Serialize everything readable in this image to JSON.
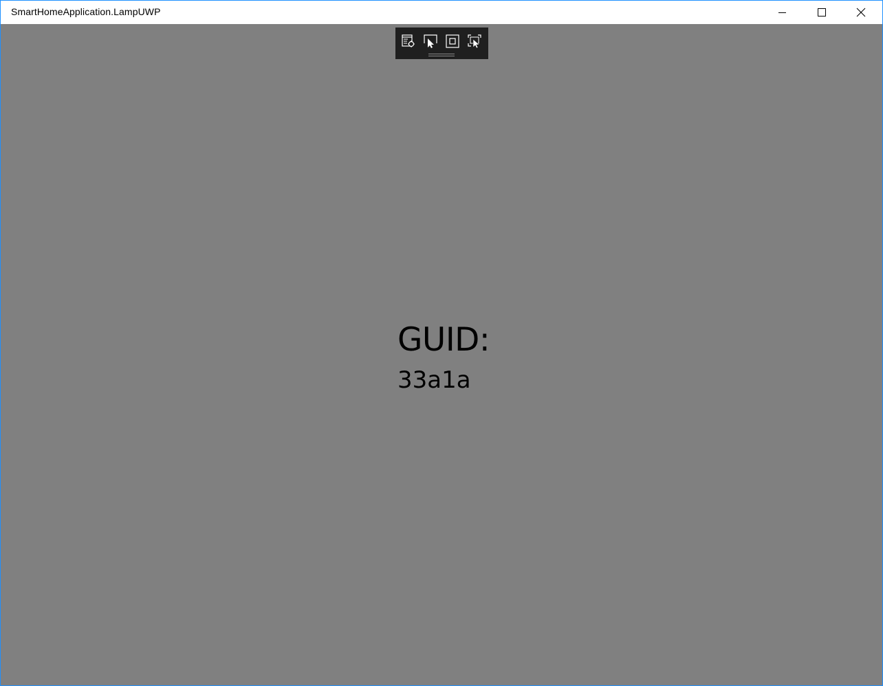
{
  "window": {
    "title": "SmartHomeApplication.LampUWP",
    "minimize_icon": "minimize-icon",
    "maximize_icon": "maximize-icon",
    "close_icon": "close-icon"
  },
  "debug_toolbar": {
    "buttons": [
      {
        "icon": "live-visual-tree-icon"
      },
      {
        "icon": "select-element-icon"
      },
      {
        "icon": "display-layout-adorners-icon"
      },
      {
        "icon": "track-focused-element-icon"
      }
    ]
  },
  "main": {
    "guid_label": "GUID:",
    "guid_value": "33a1a"
  },
  "colors": {
    "content_background": "#808080",
    "titlebar_background": "#ffffff",
    "toolbar_background": "#1f1f1f",
    "window_border": "#1e90ff",
    "text": "#000000"
  }
}
